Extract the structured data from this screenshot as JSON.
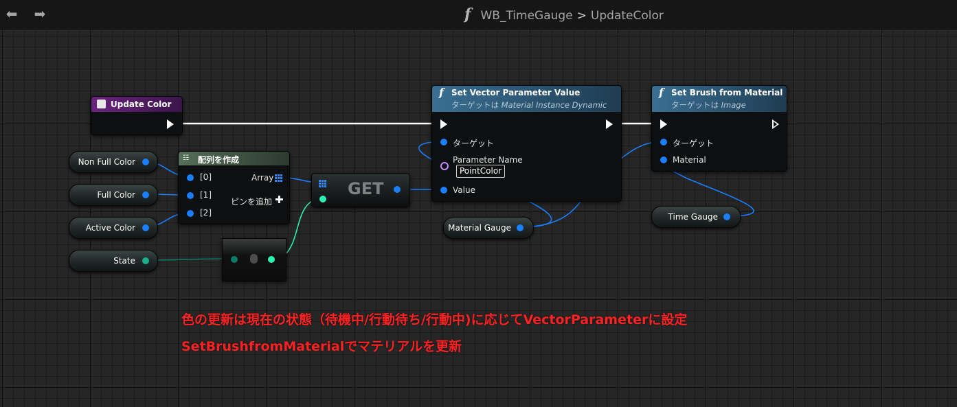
{
  "topbar": {
    "back_icon": "arrow-left-icon",
    "forward_icon": "arrow-right-icon",
    "function_glyph": "f",
    "breadcrumb_parent": "WB_TimeGauge",
    "breadcrumb_separator": ">",
    "breadcrumb_current": "UpdateColor"
  },
  "nodes": {
    "update_color": {
      "title": "Update Color"
    },
    "make_array": {
      "title": "配列を作成",
      "pins": [
        "[0]",
        "[1]",
        "[2]"
      ],
      "output": "Array",
      "add_pin": "ピンを追加"
    },
    "get": {
      "title": "GET"
    },
    "set_vector": {
      "title": "Set Vector Parameter Value",
      "subtitle_prefix": "ターゲットは",
      "subtitle_class": "Material Instance Dynamic",
      "pins": {
        "target": "ターゲット",
        "parameter_name": "Parameter Name",
        "parameter_value": "PointColor",
        "value": "Value"
      }
    },
    "set_brush": {
      "title": "Set Brush from Material",
      "subtitle_prefix": "ターゲットは",
      "subtitle_class": "Image",
      "pins": {
        "target": "ターゲット",
        "material": "Material"
      }
    }
  },
  "variables": {
    "non_full_color": "Non Full Color",
    "full_color": "Full Color",
    "active_color": "Active Color",
    "state": "State",
    "material_gauge": "Material Gauge",
    "time_gauge": "Time Gauge"
  },
  "annotations": [
    "色の更新は現在の状態（待機中/行動待ち/行動中)に応じてVectorParameterに設定",
    "SetBrushfromMaterialでマテリアルを更新"
  ],
  "colors": {
    "annotation": "#ff2222",
    "event_header": "#5b1f6e",
    "function_header": "#2f5a78",
    "pure_header": "#4c6a52",
    "object_pin": "#1a7fff",
    "struct_pin": "#1ab08a"
  }
}
